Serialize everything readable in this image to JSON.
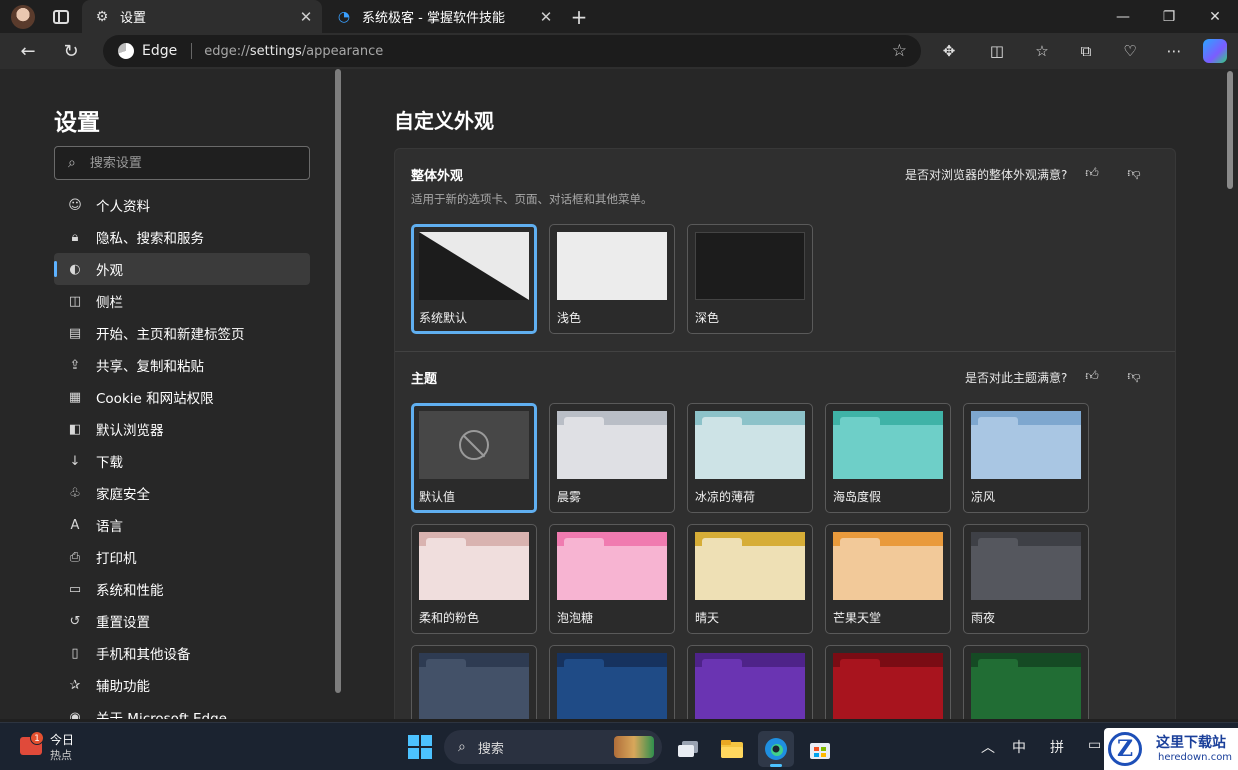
{
  "browser": {
    "tabs": [
      {
        "label": "设置",
        "icon": "gear-icon",
        "active": true
      },
      {
        "label": "系统极客 - 掌握软件技能",
        "icon": "site-icon",
        "active": false
      }
    ],
    "address": {
      "site_label": "Edge",
      "url_prefix": "edge://",
      "url_path": "settings",
      "url_rest": "/appearance"
    }
  },
  "sidebar": {
    "title": "设置",
    "search_placeholder": "搜索设置",
    "items": [
      {
        "label": "个人资料",
        "icon": "profile-icon"
      },
      {
        "label": "隐私、搜索和服务",
        "icon": "lock-icon"
      },
      {
        "label": "外观",
        "icon": "palette-icon",
        "active": true
      },
      {
        "label": "侧栏",
        "icon": "sidebar-icon"
      },
      {
        "label": "开始、主页和新建标签页",
        "icon": "home-icon"
      },
      {
        "label": "共享、复制和粘贴",
        "icon": "share-icon"
      },
      {
        "label": "Cookie 和网站权限",
        "icon": "cookie-icon"
      },
      {
        "label": "默认浏览器",
        "icon": "browser-icon"
      },
      {
        "label": "下载",
        "icon": "download-icon"
      },
      {
        "label": "家庭安全",
        "icon": "family-icon"
      },
      {
        "label": "语言",
        "icon": "language-icon"
      },
      {
        "label": "打印机",
        "icon": "printer-icon"
      },
      {
        "label": "系统和性能",
        "icon": "system-icon"
      },
      {
        "label": "重置设置",
        "icon": "reset-icon"
      },
      {
        "label": "手机和其他设备",
        "icon": "phone-icon"
      },
      {
        "label": "辅助功能",
        "icon": "accessibility-icon"
      },
      {
        "label": "关于 Microsoft Edge",
        "icon": "edge-icon"
      }
    ]
  },
  "main": {
    "title": "自定义外观",
    "appearance": {
      "title": "整体外观",
      "subtitle": "适用于新的选项卡、页面、对话框和其他菜单。",
      "feedback": "是否对浏览器的整体外观满意?",
      "options": [
        {
          "label": "系统默认",
          "selected": true
        },
        {
          "label": "浅色",
          "selected": false
        },
        {
          "label": "深色",
          "selected": false
        }
      ]
    },
    "theme": {
      "title": "主题",
      "feedback": "是否对此主题满意?",
      "options": [
        {
          "label": "默认值",
          "selected": true,
          "bar": "",
          "body": ""
        },
        {
          "label": "晨雾",
          "bar": "#b9bec6",
          "body": "#dfe0e4"
        },
        {
          "label": "冰凉的薄荷",
          "bar": "#8cc2c9",
          "body": "#cde3e6"
        },
        {
          "label": "海岛度假",
          "bar": "#3fb3a7",
          "body": "#6ecfc8"
        },
        {
          "label": "凉风",
          "bar": "#7ea7cf",
          "body": "#a9c6e3"
        },
        {
          "label": "柔和的粉色",
          "bar": "#d9b3b0",
          "body": "#f0dedd"
        },
        {
          "label": "泡泡糖",
          "bar": "#f07bb0",
          "body": "#f7b4d2"
        },
        {
          "label": "晴天",
          "bar": "#d6ad37",
          "body": "#eee0b5"
        },
        {
          "label": "芒果天堂",
          "bar": "#e99a3c",
          "body": "#f2c999"
        },
        {
          "label": "雨夜",
          "bar": "#3e4046",
          "body": "#55575e"
        },
        {
          "label": "",
          "bar": "#2e3b52",
          "body": "#435168"
        },
        {
          "label": "",
          "bar": "#16325e",
          "body": "#1f4b86"
        },
        {
          "label": "",
          "bar": "#4e2389",
          "body": "#6a34b2"
        },
        {
          "label": "",
          "bar": "#7a0c14",
          "body": "#a8141e"
        },
        {
          "label": "",
          "bar": "#154a24",
          "body": "#216d34"
        }
      ]
    }
  },
  "taskbar": {
    "weather_title": "今日",
    "weather_sub": "热点",
    "weather_badge": "1",
    "search_label": "搜索",
    "tray": {
      "ime1": "中",
      "ime2": "拼"
    }
  },
  "watermark": {
    "title": "这里下载站",
    "sub": "heredown.com",
    "letter": "Z"
  }
}
